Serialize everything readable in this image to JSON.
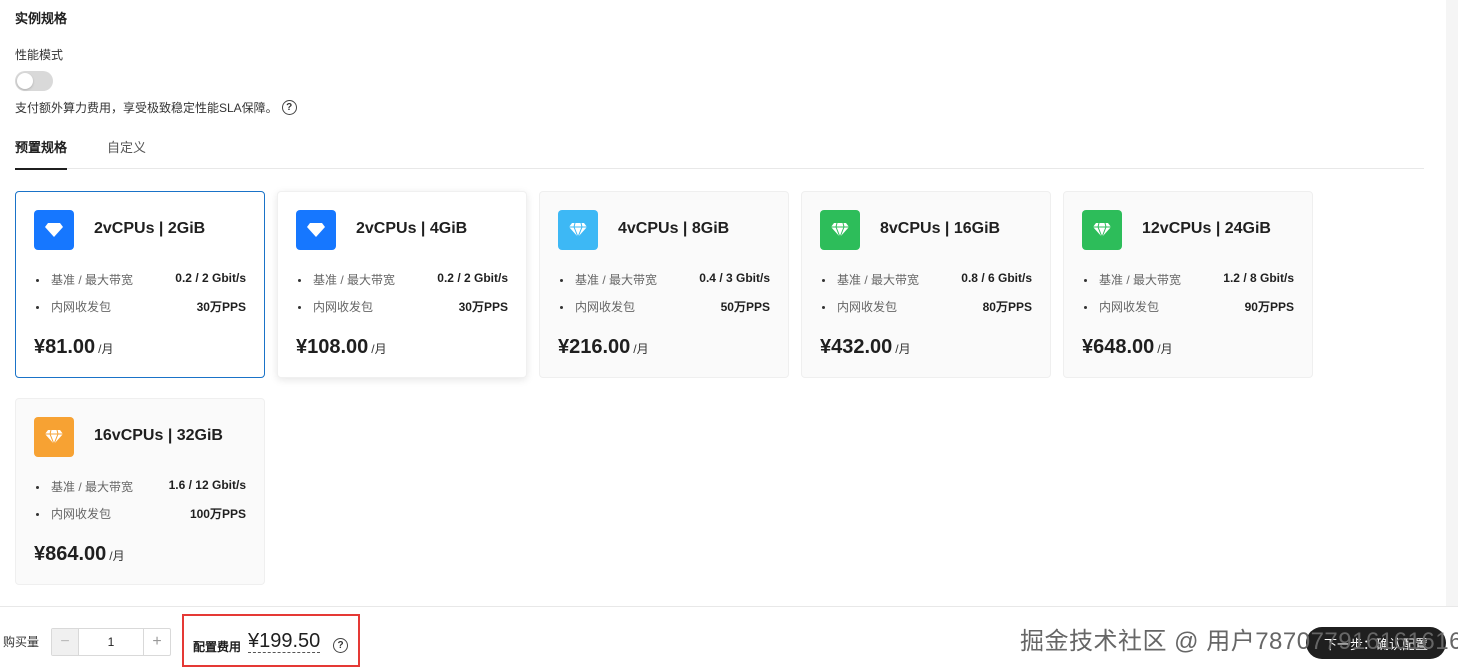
{
  "section": {
    "title": "实例规格",
    "mode_label": "性能模式",
    "mode_desc": "支付额外算力费用，享受极致稳定性能SLA保障。",
    "toggle_on": false
  },
  "tabs": [
    {
      "label": "预置规格",
      "active": true
    },
    {
      "label": "自定义",
      "active": false
    }
  ],
  "cards": [
    {
      "title": "2vCPUs | 2GiB",
      "bandwidth_label": "基准 / 最大带宽",
      "bandwidth": "0.2 / 2 Gbit/s",
      "pps_label": "内网收发包",
      "pps": "30万PPS",
      "price": "¥81.00",
      "unit": "/月",
      "icon": "diamond-icon",
      "icon_color": "#1677ff"
    },
    {
      "title": "2vCPUs | 4GiB",
      "bandwidth_label": "基准 / 最大带宽",
      "bandwidth": "0.2 / 2 Gbit/s",
      "pps_label": "内网收发包",
      "pps": "30万PPS",
      "price": "¥108.00",
      "unit": "/月",
      "icon": "diamond-icon",
      "icon_color": "#1677ff"
    },
    {
      "title": "4vCPUs | 8GiB",
      "bandwidth_label": "基准 / 最大带宽",
      "bandwidth": "0.4 / 3 Gbit/s",
      "pps_label": "内网收发包",
      "pps": "50万PPS",
      "price": "¥216.00",
      "unit": "/月",
      "icon": "gem-icon",
      "icon_color": "#3db8f5"
    },
    {
      "title": "8vCPUs | 16GiB",
      "bandwidth_label": "基准 / 最大带宽",
      "bandwidth": "0.8 / 6 Gbit/s",
      "pps_label": "内网收发包",
      "pps": "80万PPS",
      "price": "¥432.00",
      "unit": "/月",
      "icon": "gem-icon",
      "icon_color": "#2dbd5a"
    },
    {
      "title": "12vCPUs | 24GiB",
      "bandwidth_label": "基准 / 最大带宽",
      "bandwidth": "1.2 / 8 Gbit/s",
      "pps_label": "内网收发包",
      "pps": "90万PPS",
      "price": "¥648.00",
      "unit": "/月",
      "icon": "gem-icon",
      "icon_color": "#2dbd5a"
    },
    {
      "title": "16vCPUs | 32GiB",
      "bandwidth_label": "基准 / 最大带宽",
      "bandwidth": "1.6 / 12 Gbit/s",
      "pps_label": "内网收发包",
      "pps": "100万PPS",
      "price": "¥864.00",
      "unit": "/月",
      "icon": "gem-icon",
      "icon_color": "#f7a233"
    }
  ],
  "footer": {
    "qty_label": "购买量",
    "qty_value": "1",
    "minus": "−",
    "plus": "+",
    "fee_label": "配置费用",
    "fee_value": "¥199.50",
    "help": "?",
    "next_label": "下一步：确认配置",
    "watermark": "掘金技术社区 @ 用户787077916161616"
  }
}
